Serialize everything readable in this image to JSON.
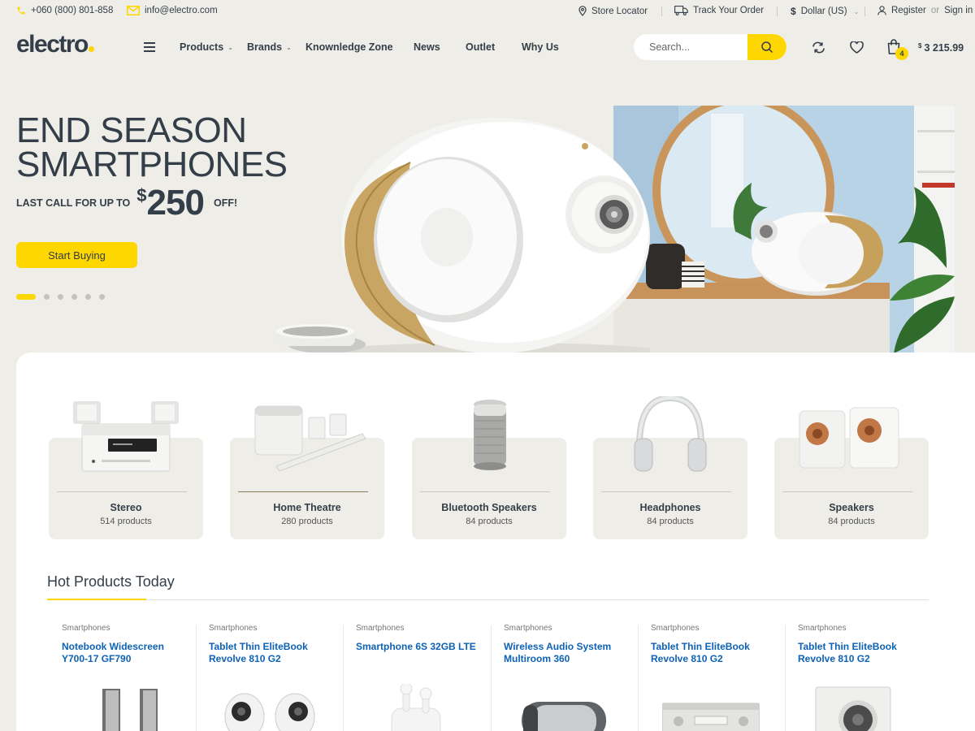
{
  "topbar": {
    "phone": "+060 (800) 801-858",
    "email": "info@electro.com",
    "store_locator": "Store Locator",
    "track_order": "Track Your Order",
    "currency": "Dollar (US)",
    "register": "Register",
    "or": "or",
    "sign_in": "Sign in"
  },
  "header": {
    "logo": "electro",
    "nav": [
      {
        "label": "Products",
        "dropdown": true
      },
      {
        "label": "Brands",
        "dropdown": true
      },
      {
        "label": "Knownledge Zone"
      },
      {
        "label": "News"
      },
      {
        "label": "Outlet"
      },
      {
        "label": "Why Us"
      }
    ],
    "search_placeholder": "Search...",
    "cart_count": "4",
    "cart_currency": "$",
    "cart_total": "3 215.99"
  },
  "hero": {
    "line1": "END SEASON",
    "line2": "SMARTPHONES",
    "sub_prefix": "LAST CALL FOR UP TO",
    "price_currency": "$",
    "price": "250",
    "sub_suffix": "OFF!",
    "cta": "Start Buying",
    "slides": 6,
    "active_slide": 1
  },
  "categories": [
    {
      "name": "Stereo",
      "count": "514 products",
      "icon": "stereo-icon"
    },
    {
      "name": "Home Theatre",
      "count": "280 products",
      "icon": "home-theatre-icon"
    },
    {
      "name": "Bluetooth Speakers",
      "count": "84 products",
      "icon": "bluetooth-speaker-icon"
    },
    {
      "name": "Headphones",
      "count": "84 products",
      "icon": "headphones-icon"
    },
    {
      "name": "Speakers",
      "count": "84 products",
      "icon": "speakers-icon"
    }
  ],
  "hot": {
    "title": "Hot Products Today",
    "products": [
      {
        "category": "Smartphones",
        "name": "Notebook Widescreen Y700-17 GF790"
      },
      {
        "category": "Smartphones",
        "name": "Tablet Thin EliteBook Revolve 810 G2"
      },
      {
        "category": "Smartphones",
        "name": "Smartphone 6S 32GB LTE"
      },
      {
        "category": "Smartphones",
        "name": "Wireless Audio System Multiroom 360"
      },
      {
        "category": "Smartphones",
        "name": "Tablet Thin EliteBook Revolve 810 G2"
      },
      {
        "category": "Smartphones",
        "name": "Tablet Thin EliteBook Revolve 810 G2"
      }
    ]
  },
  "colors": {
    "accent": "#fed700",
    "text": "#333e48",
    "link": "#0d62b5",
    "bg": "#efede8"
  }
}
